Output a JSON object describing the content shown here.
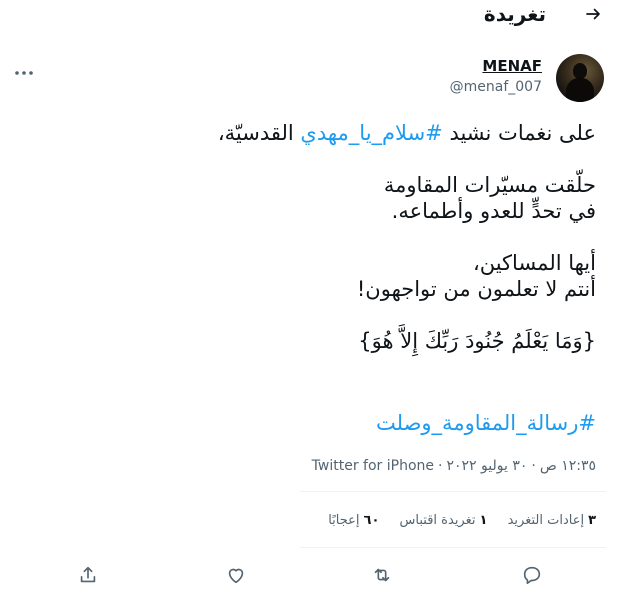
{
  "header": {
    "title": "تغريدة"
  },
  "author": {
    "display_name": "MENAF",
    "handle": "@menaf_007"
  },
  "tweet": {
    "line1_pre": "على نغمات نشيد ",
    "line1_tag": "#سلام_يا_مهدي",
    "line1_post": " القدسيّة،",
    "line2": "حلّقت مسيّرات المقاومة",
    "line3": "في تحدٍّ للعدو وأطماعه.",
    "line4": "أيها المساكين،",
    "line5": "أنتم لا تعلمون من تواجهون!",
    "line6": "{وَمَا يَعْلَمُ جُنُودَ رَبِّكَ إِلاَّ هُوَ}",
    "hashtag": "#رسالة_المقاومة_وصلت"
  },
  "meta": {
    "time": "١٢:٣٥ ص",
    "date": "٣٠ يوليو ٢٠٢٢",
    "separator": "·",
    "source": "Twitter for iPhone"
  },
  "stats": {
    "retweets_count": "٣",
    "retweets_label": "إعادات التغريد",
    "quotes_count": "١",
    "quotes_label": "تغريدة اقتباس",
    "likes_count": "٦٠",
    "likes_label": "إعجابًا"
  },
  "icons": {
    "back": "arrow-left-icon",
    "more": "more-dots-icon",
    "reply": "reply-icon",
    "retweet": "retweet-icon",
    "like": "heart-icon",
    "share": "share-icon"
  },
  "colors": {
    "accent": "#1d9bf0",
    "text": "#0f1419",
    "muted": "#536471",
    "icon": "#536471"
  }
}
